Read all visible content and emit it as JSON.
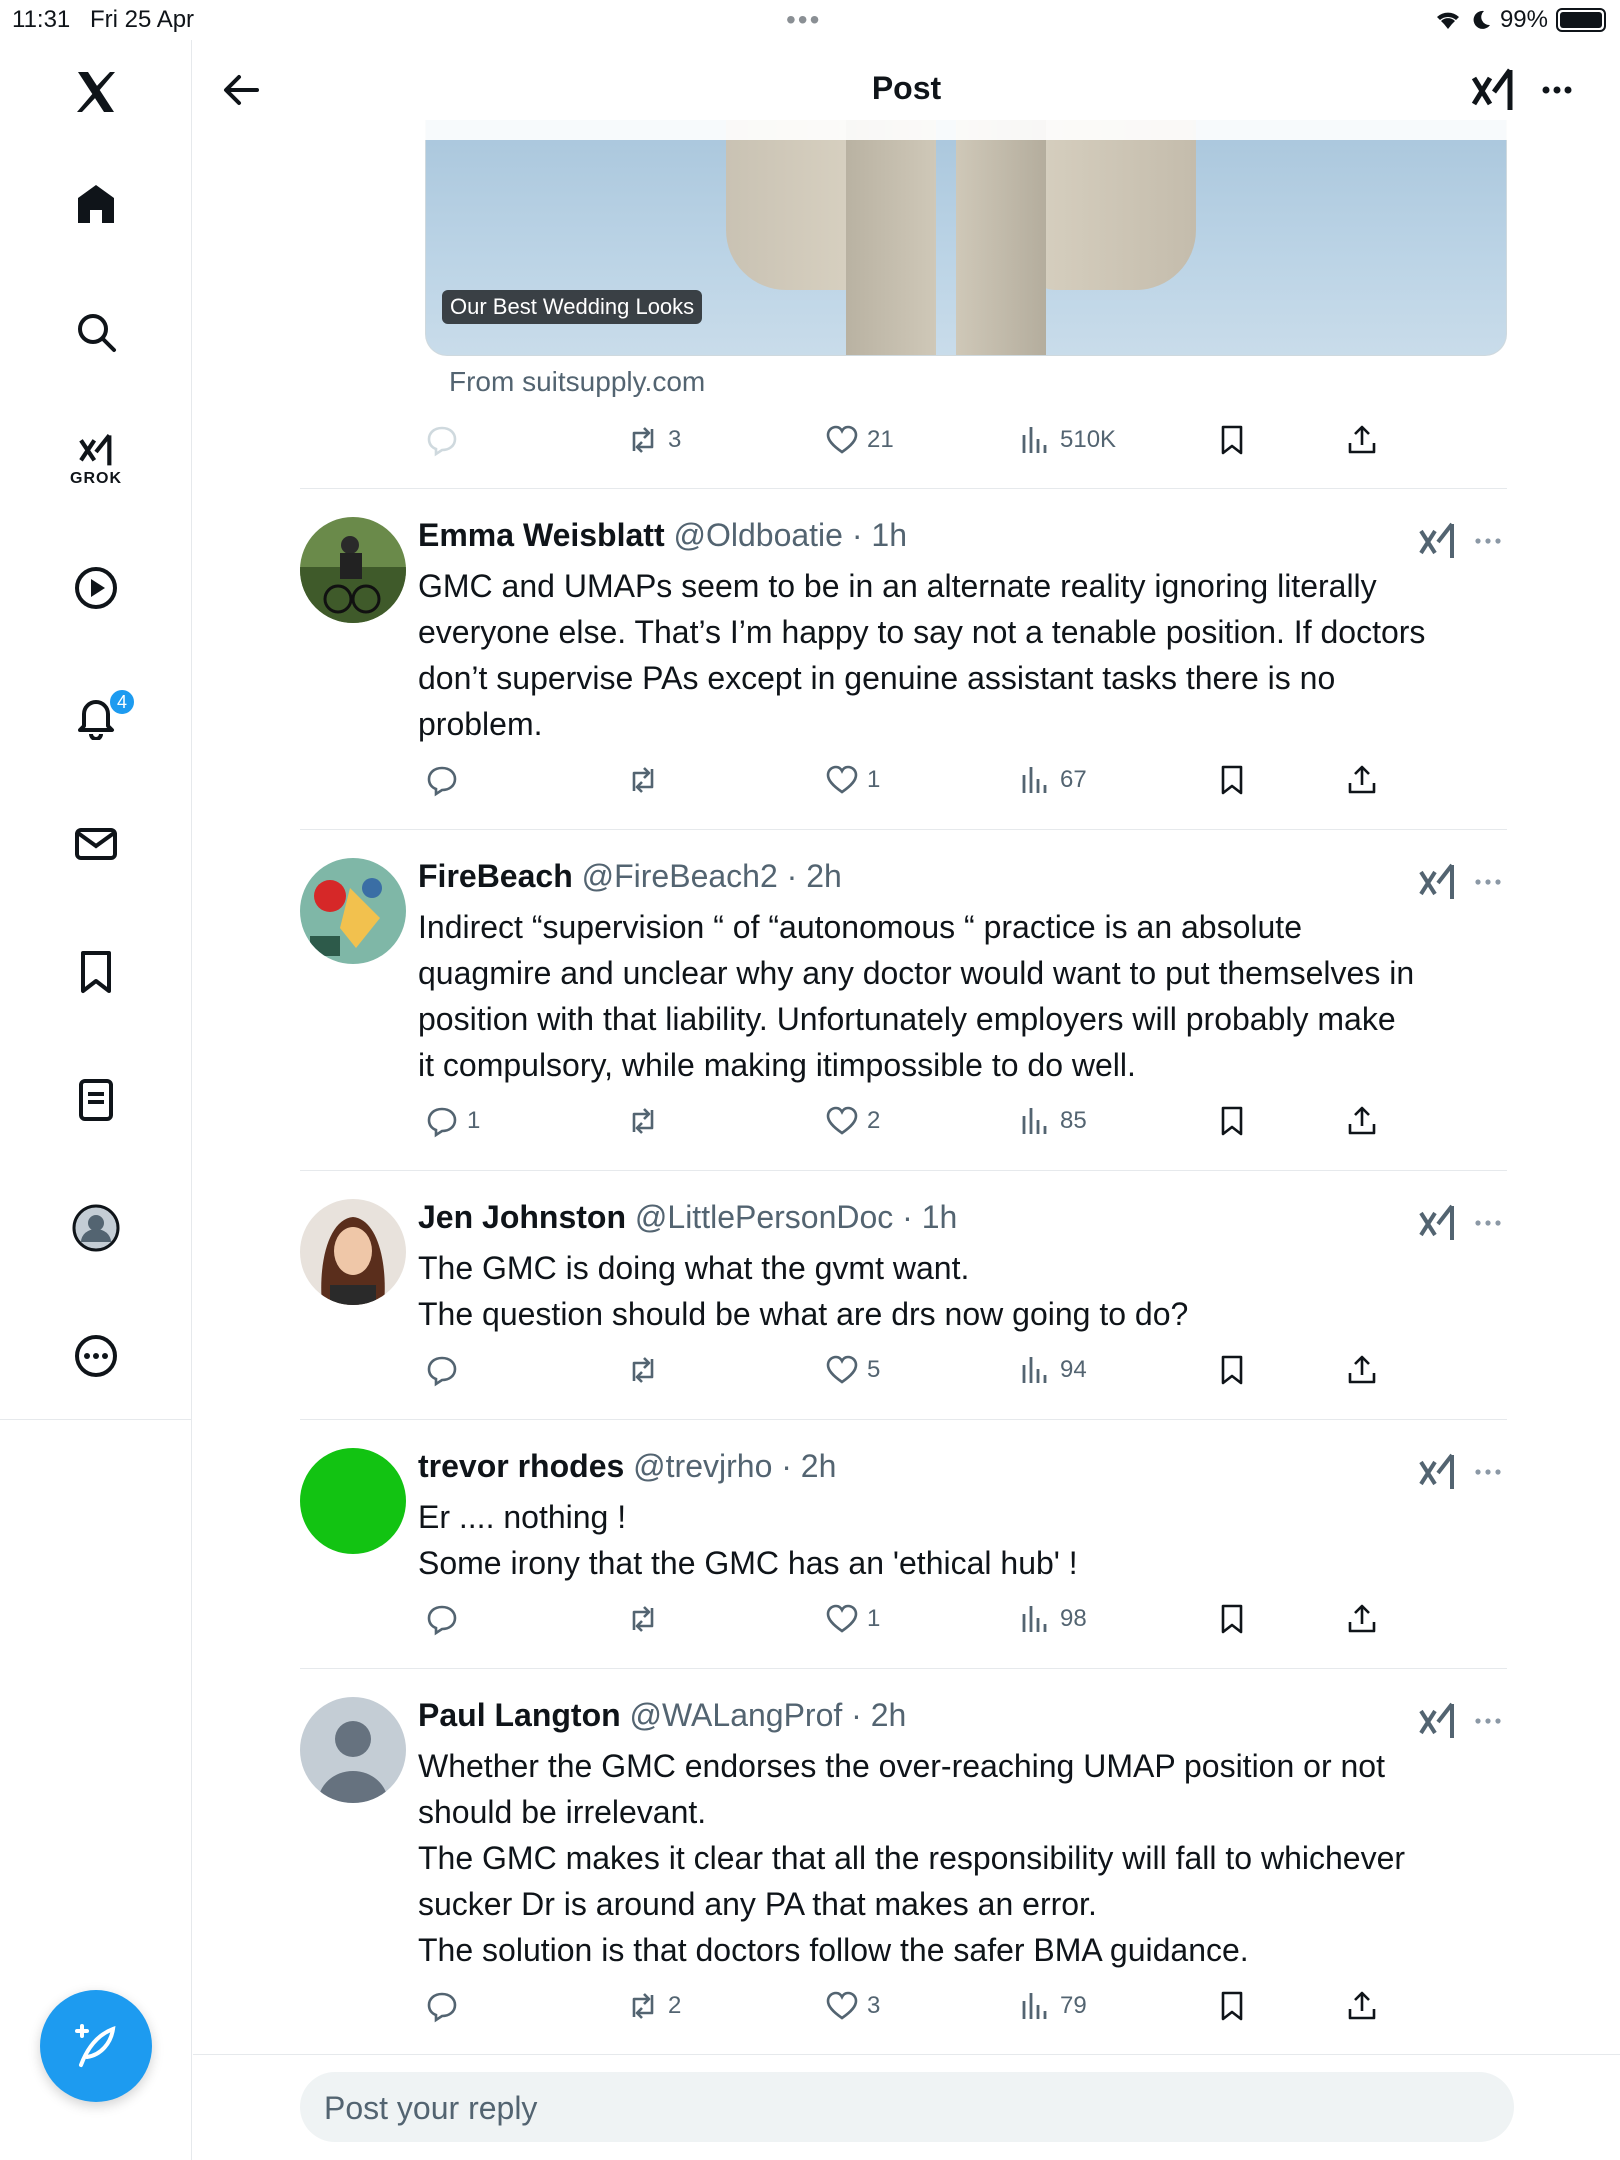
{
  "status_bar": {
    "time": "11:31",
    "date": "Fri 25 Apr",
    "battery": "99%"
  },
  "sidebar": {
    "grok_label": "GROK",
    "notifications_count": "4"
  },
  "header": {
    "title": "Post"
  },
  "media": {
    "caption": "Our Best Wedding Looks",
    "source": "From suitsupply.com"
  },
  "main_post_actions": {
    "replies": "",
    "reposts": "3",
    "likes": "21",
    "views": "510K"
  },
  "replies": [
    {
      "name": "Emma Weisblatt",
      "handle": "@Oldboatie",
      "time": "· 1h",
      "lines": [
        "GMC and UMAPs seem to be in an alternate reality ignoring literally",
        "everyone else. That’s I’m happy to say not a tenable position. If doctors",
        "don’t supervise PAs except in genuine assistant tasks there is no",
        "problem."
      ],
      "replies": "",
      "reposts": "",
      "likes": "1",
      "views": "67"
    },
    {
      "name": "FireBeach",
      "handle": "@FireBeach2",
      "time": "· 2h",
      "lines": [
        "Indirect “supervision “ of “autonomous “ practice is an absolute",
        "quagmire and unclear why any doctor would want to put themselves in",
        "position with that liability. Unfortunately employers will probably make",
        "it compulsory, while making itimpossible to do well."
      ],
      "replies": "1",
      "reposts": "",
      "likes": "2",
      "views": "85"
    },
    {
      "name": "Jen Johnston",
      "handle": "@LittlePersonDoc",
      "time": "· 1h",
      "lines": [
        "The GMC is doing what the gvmt want.",
        "The question should be what are drs now going to do?"
      ],
      "replies": "",
      "reposts": "",
      "likes": "5",
      "views": "94"
    },
    {
      "name": "trevor rhodes",
      "handle": "@trevjrho",
      "time": "· 2h",
      "lines": [
        "Er .... nothing !",
        "Some irony that the GMC has an 'ethical hub' !"
      ],
      "replies": "",
      "reposts": "",
      "likes": "1",
      "views": "98"
    },
    {
      "name": "Paul Langton",
      "handle": "@WALangProf",
      "time": "· 2h",
      "lines": [
        "Whether the GMC endorses the over-reaching UMAP position or not",
        "should be irrelevant.",
        "The GMC makes it clear that all the responsibility will fall to whichever",
        "sucker Dr is around any PA that makes an error.",
        "The solution is that doctors follow the safer BMA guidance."
      ],
      "replies": "",
      "reposts": "2",
      "likes": "3",
      "views": "79"
    }
  ],
  "reply_bar": {
    "placeholder": "Post your reply"
  },
  "colors": {
    "accent": "#1d9bf0",
    "text": "#0f1419",
    "muted": "#536471",
    "border": "#e6e9ec"
  }
}
